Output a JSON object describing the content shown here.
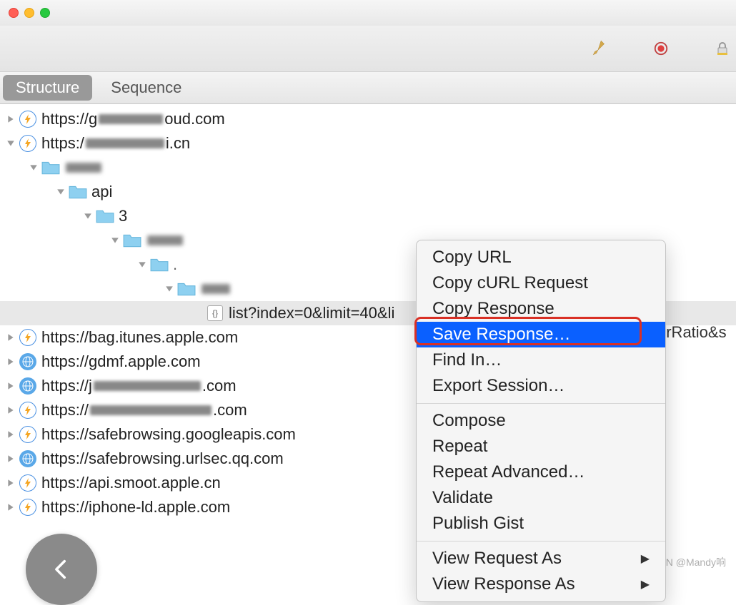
{
  "tabs": {
    "structure": "Structure",
    "sequence": "Sequence"
  },
  "tree": {
    "hosts": [
      {
        "label": "https://g",
        "suffix": "oud.com",
        "icon": "lightning",
        "expanded": false,
        "redactWidth": 90
      },
      {
        "label": "https:/",
        "suffix": "i.cn",
        "icon": "lightning",
        "expanded": true,
        "redactWidth": 110
      }
    ],
    "expandedPath": {
      "folder1": "",
      "folder2": "api",
      "folder3": "3",
      "folder4": "",
      "folder5": "",
      "folder6": ""
    },
    "selectedRequest": "list?index=0&limit=40&li",
    "moreHosts": [
      {
        "label": "https://bag.itunes.apple.com",
        "icon": "lightning"
      },
      {
        "label": "https://gdmf.apple.com",
        "icon": "globe"
      },
      {
        "label": "https://j",
        "suffix": ".com",
        "icon": "globe",
        "redactWidth": 150
      },
      {
        "label": "https://",
        "suffix": ".com",
        "icon": "lightning",
        "redactWidth": 170
      },
      {
        "label": "https://safebrowsing.googleapis.com",
        "icon": "lightning"
      },
      {
        "label": "https://safebrowsing.urlsec.qq.com",
        "icon": "globe"
      },
      {
        "label": "https://api.smoot.apple.cn",
        "icon": "lightning"
      },
      {
        "label": "https://iphone-ld.apple.com",
        "icon": "lightning"
      }
    ]
  },
  "urlTail": "erRatio&s",
  "contextMenu": {
    "items1": [
      "Copy URL",
      "Copy cURL Request",
      "Copy Response",
      "Save Response…",
      "Find In…",
      "Export Session…"
    ],
    "items2": [
      "Compose",
      "Repeat",
      "Repeat Advanced…",
      "Validate",
      "Publish Gist"
    ],
    "items3": [
      {
        "label": "View Request As",
        "sub": true
      },
      {
        "label": "View Response As",
        "sub": true
      }
    ],
    "highlightedIndex": 3
  },
  "watermark": "CSDN @Mandy响"
}
